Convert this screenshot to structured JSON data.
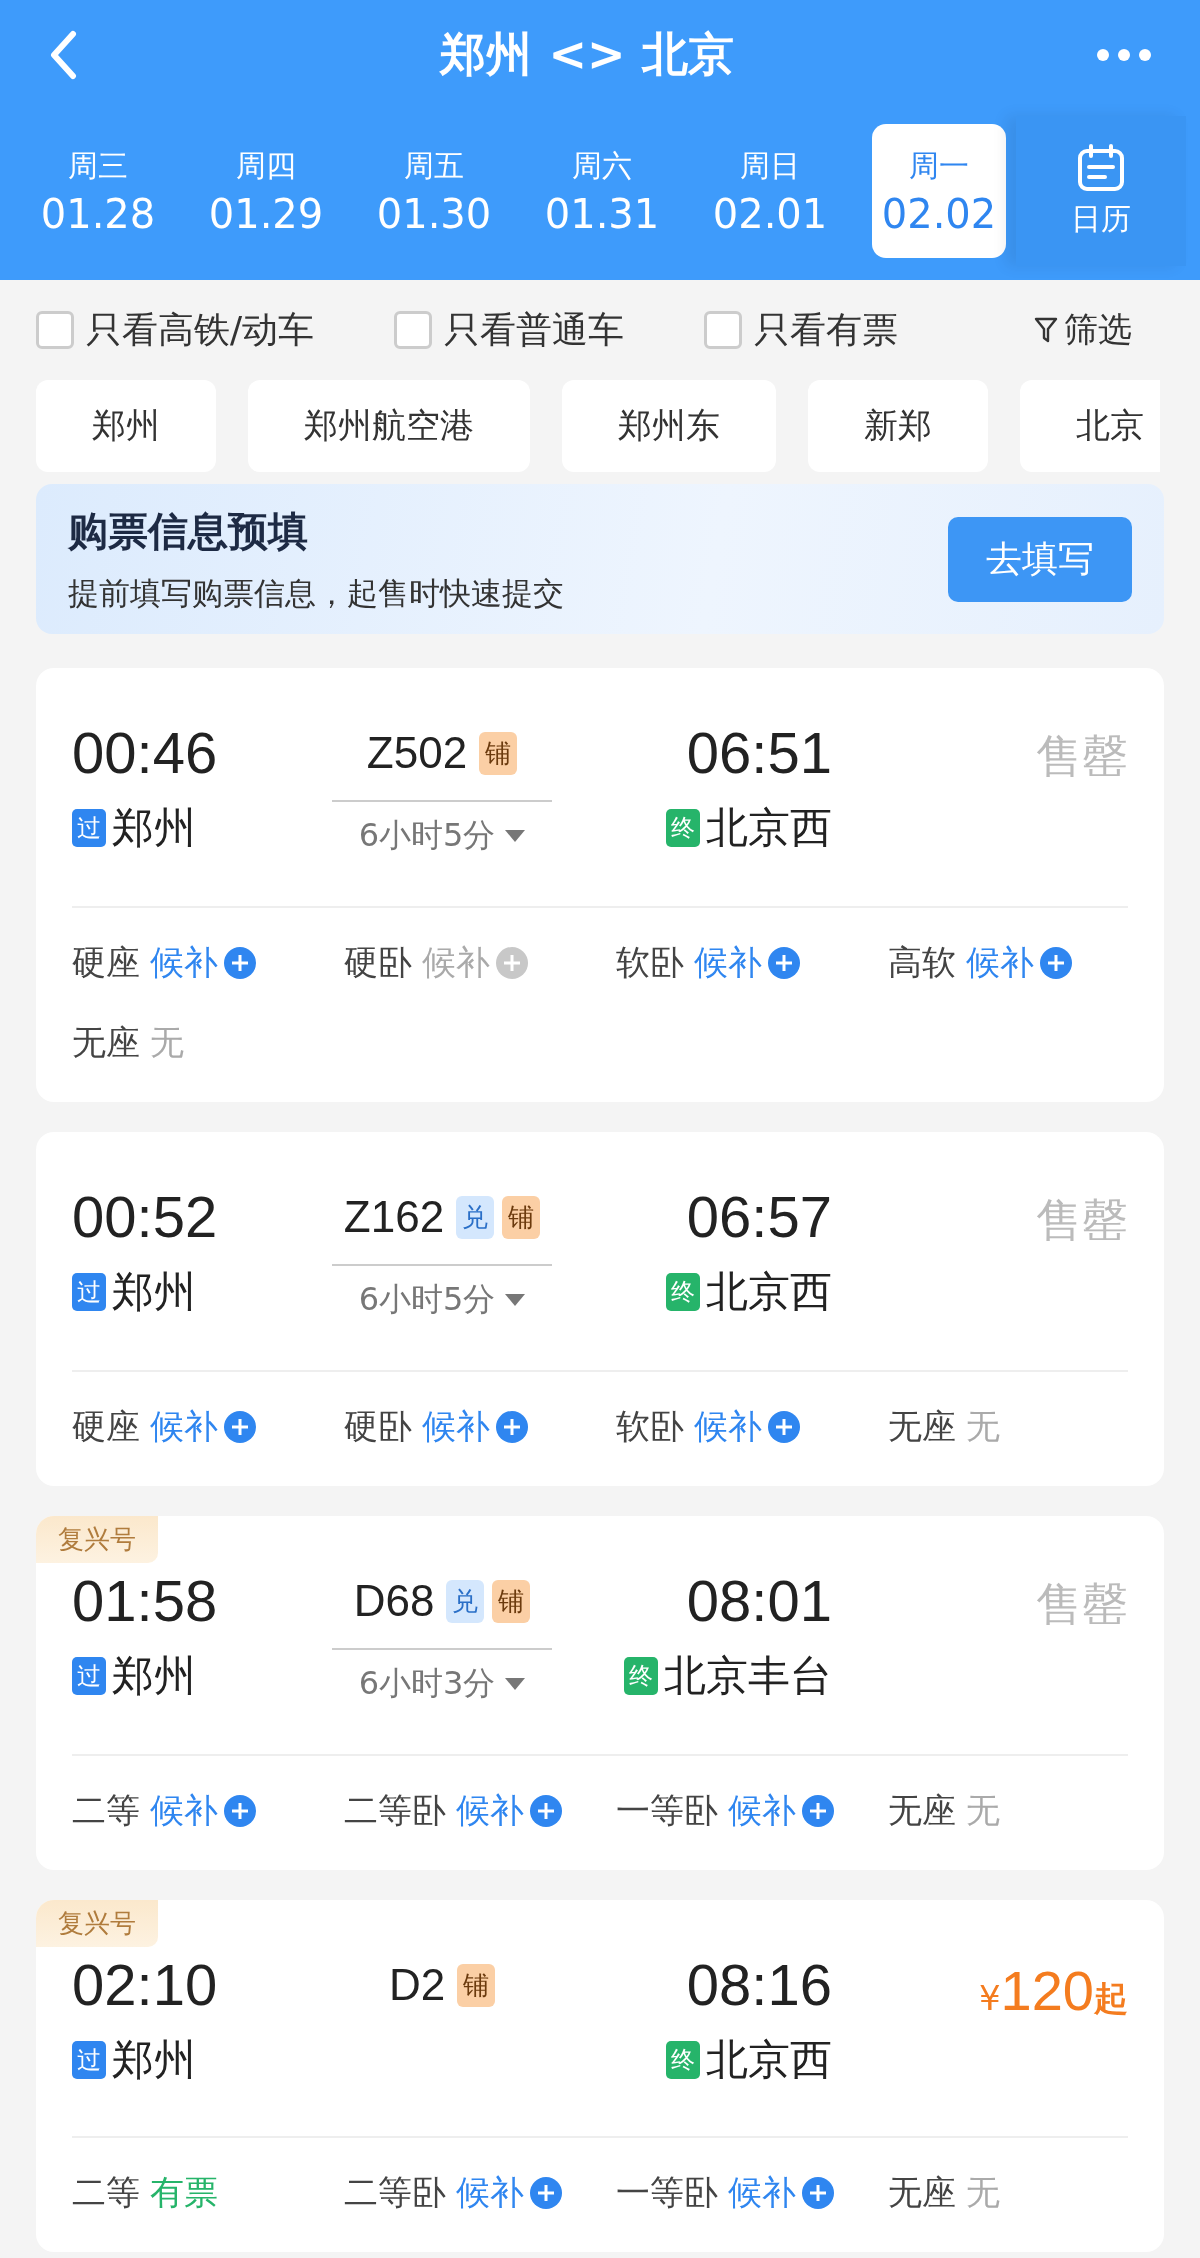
{
  "header": {
    "title": "郑州 <> 北京"
  },
  "dates": [
    {
      "weekday": "周三",
      "date": "01.28",
      "selected": false
    },
    {
      "weekday": "周四",
      "date": "01.29",
      "selected": false
    },
    {
      "weekday": "周五",
      "date": "01.30",
      "selected": false
    },
    {
      "weekday": "周六",
      "date": "01.31",
      "selected": false
    },
    {
      "weekday": "周日",
      "date": "02.01",
      "selected": false
    },
    {
      "weekday": "周一",
      "date": "02.02",
      "selected": true
    }
  ],
  "calendar_button": "日历",
  "filters": [
    {
      "label": "只看高铁/动车",
      "checked": false
    },
    {
      "label": "只看普通车",
      "checked": false
    },
    {
      "label": "只看有票",
      "checked": false
    }
  ],
  "filter_button": "筛选",
  "stations": [
    "郑州",
    "郑州航空港",
    "郑州东",
    "新郑",
    "北京"
  ],
  "banner": {
    "title": "购票信息预填",
    "subtitle": "提前填写购票信息，起售时快速提交",
    "button": "去填写"
  },
  "trains": [
    {
      "depart": "00:46",
      "from_badge": {
        "kind": "pass",
        "text": "过"
      },
      "from": "郑州",
      "number": "Z502",
      "tags": [
        {
          "kind": "sleeper",
          "text": "铺"
        }
      ],
      "duration": "6小时5分",
      "arrive": "06:51",
      "to_badge": {
        "kind": "terminal",
        "text": "终"
      },
      "to": "北京西",
      "availability": {
        "kind": "sold_out",
        "text": "售罄"
      },
      "seats": [
        {
          "name": "硬座",
          "status": "候补",
          "kind": "waitlist"
        },
        {
          "name": "硬卧",
          "status": "候补",
          "kind": "waitlist_off"
        },
        {
          "name": "软卧",
          "status": "候补",
          "kind": "waitlist"
        },
        {
          "name": "高软",
          "status": "候补",
          "kind": "waitlist"
        },
        {
          "name": "无座",
          "status": "无",
          "kind": "none"
        }
      ]
    },
    {
      "depart": "00:52",
      "from_badge": {
        "kind": "pass",
        "text": "过"
      },
      "from": "郑州",
      "number": "Z162",
      "tags": [
        {
          "kind": "redeem",
          "text": "兑"
        },
        {
          "kind": "sleeper",
          "text": "铺"
        }
      ],
      "duration": "6小时5分",
      "arrive": "06:57",
      "to_badge": {
        "kind": "terminal",
        "text": "终"
      },
      "to": "北京西",
      "availability": {
        "kind": "sold_out",
        "text": "售罄"
      },
      "seats": [
        {
          "name": "硬座",
          "status": "候补",
          "kind": "waitlist"
        },
        {
          "name": "硬卧",
          "status": "候补",
          "kind": "waitlist"
        },
        {
          "name": "软卧",
          "status": "候补",
          "kind": "waitlist"
        },
        {
          "name": "无座",
          "status": "无",
          "kind": "none"
        }
      ]
    },
    {
      "label": "复兴号",
      "depart": "01:58",
      "from_badge": {
        "kind": "pass",
        "text": "过"
      },
      "from": "郑州",
      "number": "D68",
      "tags": [
        {
          "kind": "redeem",
          "text": "兑"
        },
        {
          "kind": "sleeper",
          "text": "铺"
        }
      ],
      "duration": "6小时3分",
      "arrive": "08:01",
      "to_badge": {
        "kind": "terminal",
        "text": "终"
      },
      "to": "北京丰台",
      "availability": {
        "kind": "sold_out",
        "text": "售罄"
      },
      "seats": [
        {
          "name": "二等",
          "status": "候补",
          "kind": "waitlist"
        },
        {
          "name": "二等卧",
          "status": "候补",
          "kind": "waitlist"
        },
        {
          "name": "一等卧",
          "status": "候补",
          "kind": "waitlist"
        },
        {
          "name": "无座",
          "status": "无",
          "kind": "none"
        }
      ]
    },
    {
      "label": "复兴号",
      "depart": "02:10",
      "from_badge": {
        "kind": "pass",
        "text": "过"
      },
      "from": "郑州",
      "number": "D2",
      "tags": [
        {
          "kind": "sleeper",
          "text": "铺"
        }
      ],
      "arrive": "08:16",
      "to_badge": {
        "kind": "terminal",
        "text": "终"
      },
      "to": "北京西",
      "availability": {
        "kind": "price",
        "currency": "¥",
        "amount": "120",
        "suffix": "起"
      },
      "seats": [
        {
          "name": "二等",
          "status": "有票",
          "kind": "available"
        },
        {
          "name": "二等卧",
          "status": "候补",
          "kind": "waitlist"
        },
        {
          "name": "一等卧",
          "status": "候补",
          "kind": "waitlist"
        },
        {
          "name": "无座",
          "status": "无",
          "kind": "none"
        }
      ]
    }
  ]
}
